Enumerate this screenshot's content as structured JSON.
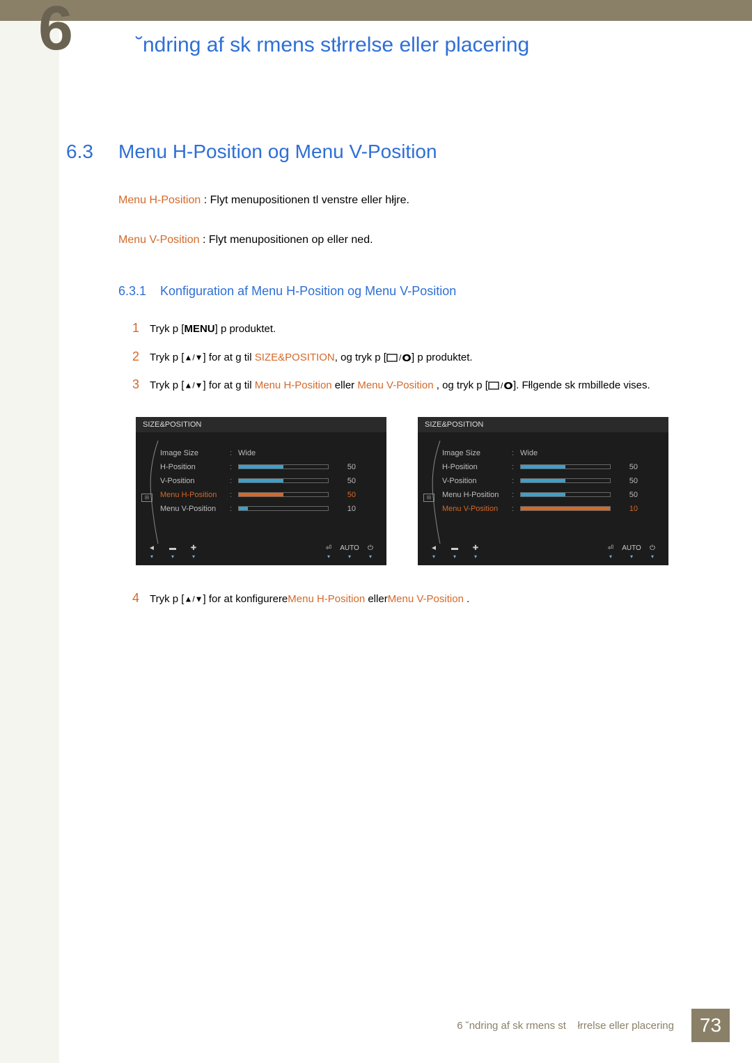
{
  "chapter_badge": "6",
  "chapter_title": "˘ndring af sk rmens stłrrelse eller placering",
  "section": {
    "num": "6.3",
    "title": "Menu H-Position og Menu V-Position"
  },
  "desc1_label": "Menu H-Position",
  "desc1_text": " : Flyt menupositionen tl venstre eller hłjre.",
  "desc2_label": "Menu V-Position",
  "desc2_text": " : Flyt menupositionen op eller ned.",
  "subsection": {
    "num": "6.3.1",
    "title": "Konfiguration af Menu H-Position og Menu V-Position"
  },
  "steps": {
    "s1": {
      "n": "1",
      "a": "Tryk p  [",
      "menu": "MENU",
      "b": "] p  produktet."
    },
    "s2": {
      "n": "2",
      "a": "Tryk p  [",
      "ud": "▲/▼",
      "b": "] for at g  til ",
      "sp": "SIZE&POSITION",
      "c": ", og tryk p  [",
      "d": "] p  produktet."
    },
    "s3": {
      "n": "3",
      "a": "Tryk p  [",
      "ud": "▲/▼",
      "b": "] for at g  til ",
      "mh": "Menu H-Position",
      "c": " eller ",
      "mv": "Menu V-Position",
      "d": " , og tryk p  [",
      "e": "]. Fłlgende sk rmbillede vises."
    },
    "s4": {
      "n": "4",
      "a": "Tryk p  [",
      "ud": "▲/▼",
      "b": "] for at konfigurere",
      "mh": "Menu H-Position",
      "c": " eller",
      "mv": "Menu V-Position",
      "d": " ."
    }
  },
  "osd": {
    "header": "SIZE&POSITION",
    "rows": {
      "imageSize": {
        "label": "Image Size",
        "value": "Wide"
      },
      "hpos": {
        "label": "H-Position",
        "value": "50",
        "fill": 50
      },
      "vpos": {
        "label": "V-Position",
        "value": "50",
        "fill": 50
      },
      "mhpos": {
        "label": "Menu H-Position",
        "value": "50",
        "fill": 50
      },
      "mvpos": {
        "label": "Menu V-Position",
        "value": "10",
        "fill": 10
      }
    },
    "footer": {
      "auto": "AUTO"
    }
  },
  "footer": {
    "chap": "6 ˘ndring af sk rmens st",
    "chap2": "łrrelse eller placering",
    "page": "73"
  }
}
